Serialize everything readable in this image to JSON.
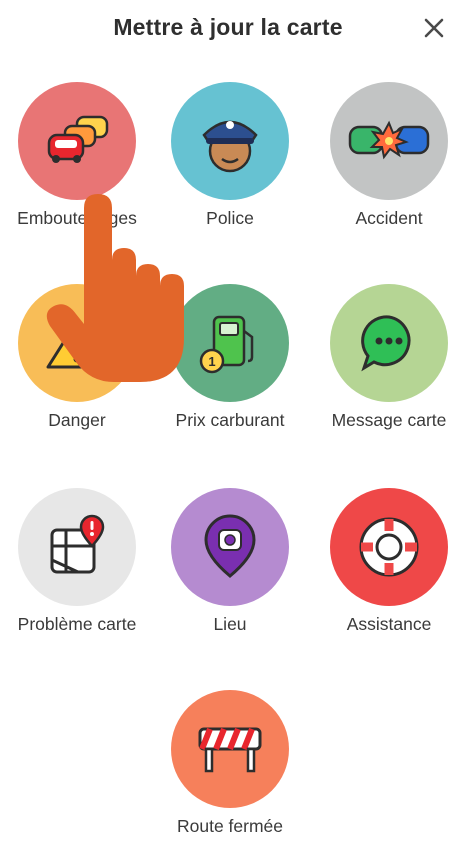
{
  "header": {
    "title": "Mettre à jour la carte"
  },
  "items": [
    {
      "label": "Embouteillages",
      "icon": "traffic-jam-icon",
      "color": "#e87575"
    },
    {
      "label": "Police",
      "icon": "police-icon",
      "color": "#66c2d2"
    },
    {
      "label": "Accident",
      "icon": "accident-icon",
      "color": "#c2c4c4"
    },
    {
      "label": "Danger",
      "icon": "hazard-icon",
      "color": "#f8bd57"
    },
    {
      "label": "Prix carburant",
      "icon": "fuel-price-icon",
      "color": "#62ad84"
    },
    {
      "label": "Message carte",
      "icon": "map-chat-icon",
      "color": "#b5d594"
    },
    {
      "label": "Problème carte",
      "icon": "map-issue-icon",
      "color": "#e7e7e7"
    },
    {
      "label": "Lieu",
      "icon": "place-icon",
      "color": "#b58bd0"
    },
    {
      "label": "Assistance",
      "icon": "roadside-help-icon",
      "color": "#ef4848"
    },
    {
      "label": "Route fermée",
      "icon": "road-closed-icon",
      "color": "#f6805b"
    }
  ],
  "overlay": {
    "icon": "pointing-hand-icon",
    "color": "#e2662a"
  }
}
